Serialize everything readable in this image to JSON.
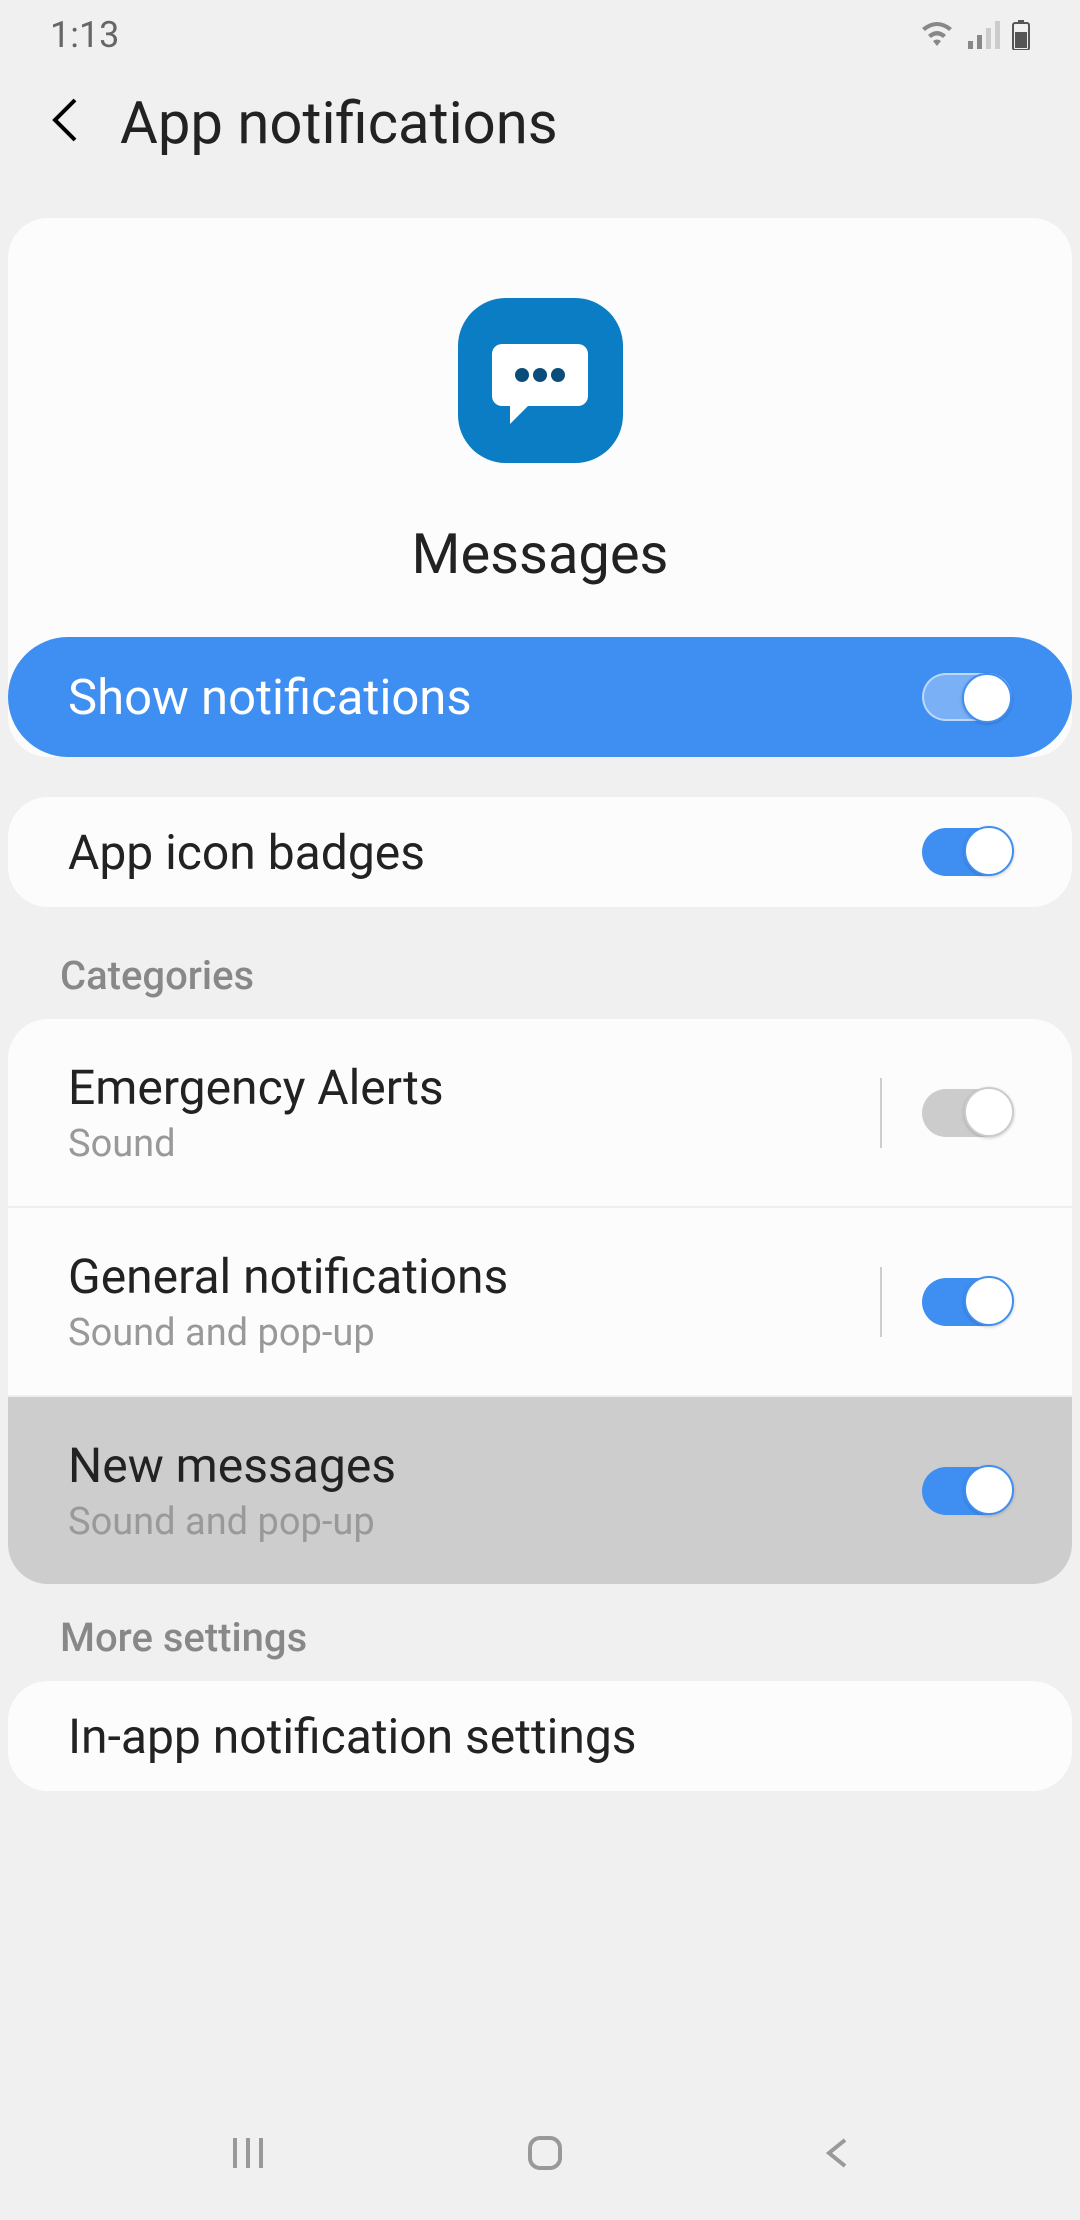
{
  "status": {
    "time": "1:13"
  },
  "header": {
    "title": "App notifications"
  },
  "app": {
    "name": "Messages"
  },
  "show_notifications": {
    "label": "Show notifications",
    "enabled": true
  },
  "badges": {
    "label": "App icon badges",
    "enabled": true
  },
  "sections": {
    "categories_label": "Categories",
    "more_settings_label": "More settings"
  },
  "categories": [
    {
      "title": "Emergency Alerts",
      "sub": "Sound",
      "enabled": false,
      "selected": false
    },
    {
      "title": "General notifications",
      "sub": "Sound and pop-up",
      "enabled": true,
      "selected": false
    },
    {
      "title": "New messages",
      "sub": "Sound and pop-up",
      "enabled": true,
      "selected": true
    }
  ],
  "more_settings": {
    "in_app_label": "In-app notification settings"
  }
}
